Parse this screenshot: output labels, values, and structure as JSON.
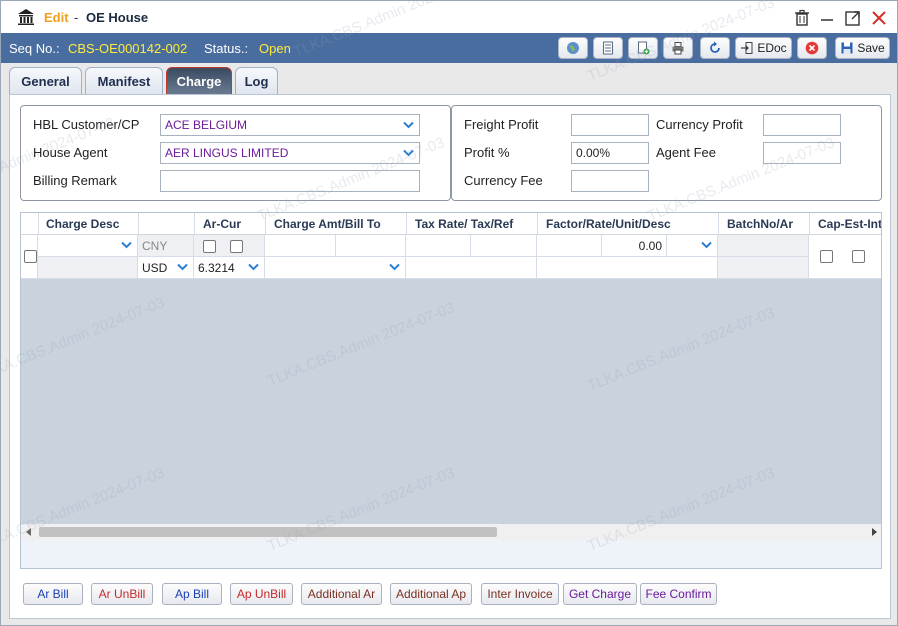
{
  "window": {
    "edit_label": "Edit",
    "separator": "-",
    "title": "OE House"
  },
  "header": {
    "seq_label": "Seq No.:",
    "seq_value": "CBS-OE000142-002",
    "status_label": "Status.:",
    "status_value": "Open",
    "edoc_label": "EDoc",
    "save_label": "Save"
  },
  "tabs": [
    {
      "label": "General"
    },
    {
      "label": "Manifest"
    },
    {
      "label": "Charge",
      "active": true
    },
    {
      "label": "Log"
    }
  ],
  "form": {
    "hbl_customer_label": "HBL Customer/CP",
    "hbl_customer_value": "ACE BELGIUM",
    "house_agent_label": "House Agent",
    "house_agent_value": "AER LINGUS LIMITED",
    "billing_remark_label": "Billing Remark",
    "billing_remark_value": "",
    "freight_profit_label": "Freight Profit",
    "freight_profit_value": "",
    "profit_pct_label": "Profit %",
    "profit_pct_value": "0.00%",
    "currency_fee_label": "Currency Fee",
    "currency_fee_value": "",
    "currency_profit_label": "Currency Profit",
    "currency_profit_value": "",
    "agent_fee_label": "Agent Fee",
    "agent_fee_value": ""
  },
  "grid": {
    "columns": [
      "Charge Desc",
      "Ar-Cur",
      "Charge Amt/Bill To",
      "Tax Rate/ Tax/Ref",
      "Factor/Rate/Unit/Desc",
      "BatchNo/Ar",
      "Cap-Est-Int"
    ],
    "row1": {
      "currency_top": "CNY",
      "factor_value": "0.00"
    },
    "row2": {
      "currency": "USD",
      "rate": "6.3214"
    }
  },
  "buttons": {
    "ar_bill": "Ar Bill",
    "ar_unbill": "Ar UnBill",
    "ap_bill": "Ap Bill",
    "ap_unbill": "Ap UnBill",
    "additional_ar": "Additional Ar",
    "additional_ap": "Additional Ap",
    "inter_invoice": "Inter Invoice",
    "get_charge": "Get Charge",
    "fee_confirm": "Fee Confirm"
  },
  "colors": {
    "header_bg": "#4a6da0",
    "highlight": "#ffeb3b",
    "edit_orange": "#f0a020",
    "red_button_text": "#c62828",
    "blue_button_text": "#1a3fb5",
    "brown_button_text": "#7a3020",
    "purple_value": "#6a1b9a"
  },
  "watermark": "TLKA.CBS.Admin 2024-07-03"
}
